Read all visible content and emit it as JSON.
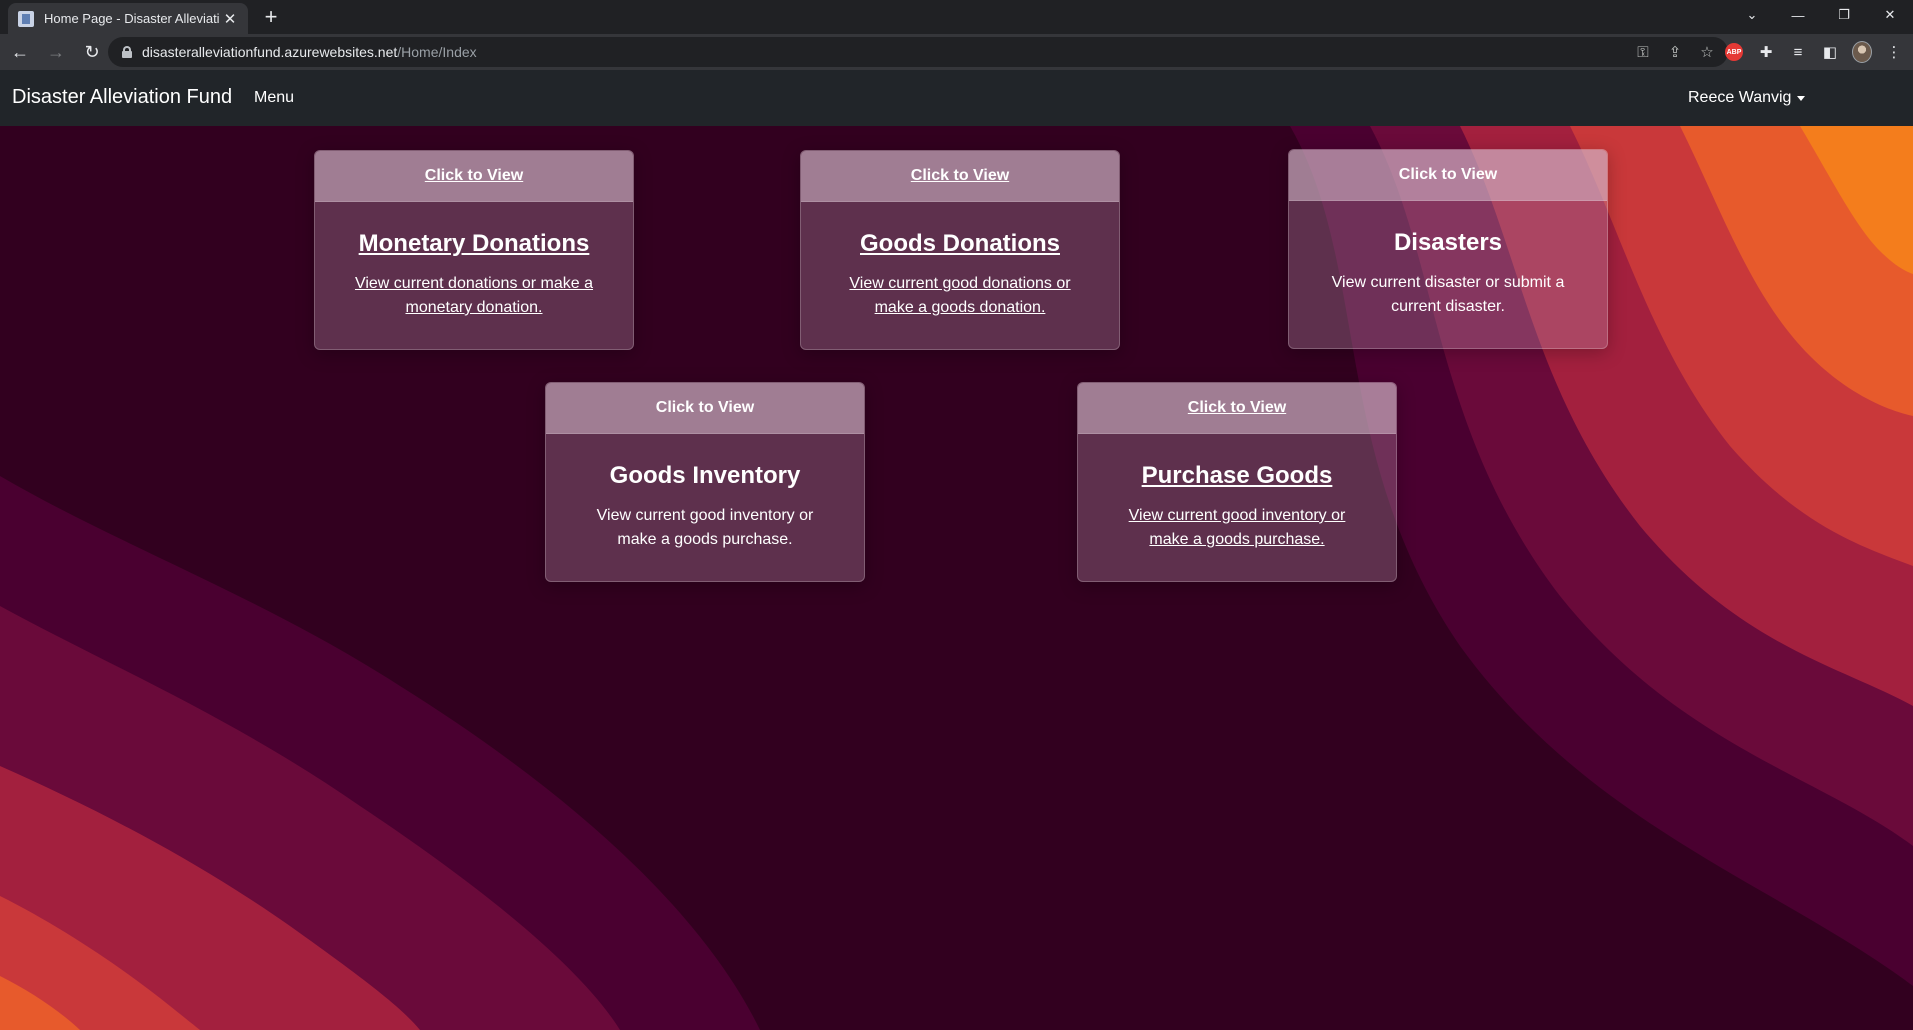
{
  "browser": {
    "tab_title": "Home Page - Disaster Alleviation",
    "url_host": "disasteralleviationfund.azurewebsites.net",
    "url_path": "/Home/Index"
  },
  "navbar": {
    "brand": "Disaster Alleviation Fund",
    "menu": "Menu",
    "user": "Reece Wanvig"
  },
  "cards": [
    {
      "header": "Click to View",
      "title": "Monetary Donations",
      "text": "View current donations or make a monetary donation."
    },
    {
      "header": "Click to View",
      "title": "Goods Donations",
      "text": "View current good donations or make a goods donation."
    },
    {
      "header": "Click to View",
      "title": "Disasters",
      "text": "View current disaster or submit a current disaster."
    },
    {
      "header": "Click to View",
      "title": "Goods Inventory",
      "text": "View current good inventory or make a goods purchase."
    },
    {
      "header": "Click to View",
      "title": "Purchase Goods",
      "text": "View current good inventory or make a goods purchase."
    }
  ]
}
